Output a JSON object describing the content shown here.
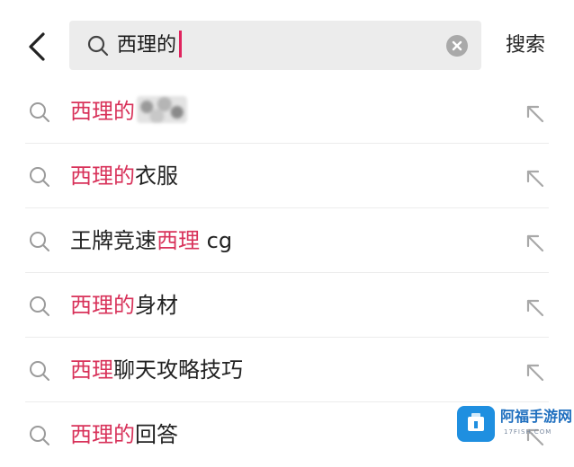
{
  "header": {
    "back_icon": "chevron-left-icon",
    "search": {
      "query": "西理的",
      "search_icon": "search-icon",
      "clear_icon": "clear-circle-icon"
    },
    "search_button_label": "搜索"
  },
  "suggestions": [
    {
      "highlight": "西理的",
      "rest": "",
      "has_blurred_image": true
    },
    {
      "highlight": "西理的",
      "rest": "衣服"
    },
    {
      "prefix": "王牌竞速",
      "highlight": "西理",
      "rest": " cg"
    },
    {
      "highlight": "西理的",
      "rest": "身材"
    },
    {
      "highlight": "西理",
      "rest": "聊天攻略技巧"
    },
    {
      "highlight": "西理的",
      "rest": "回答"
    }
  ],
  "suggestion_icon": "search-icon",
  "fill_icon": "arrow-up-left-icon",
  "watermark": {
    "title": "阿福手游网",
    "subtitle": "17FISH.COM"
  },
  "colors": {
    "highlight": "#d8325a",
    "caret": "#e0245e",
    "search_bg": "#ececec"
  }
}
